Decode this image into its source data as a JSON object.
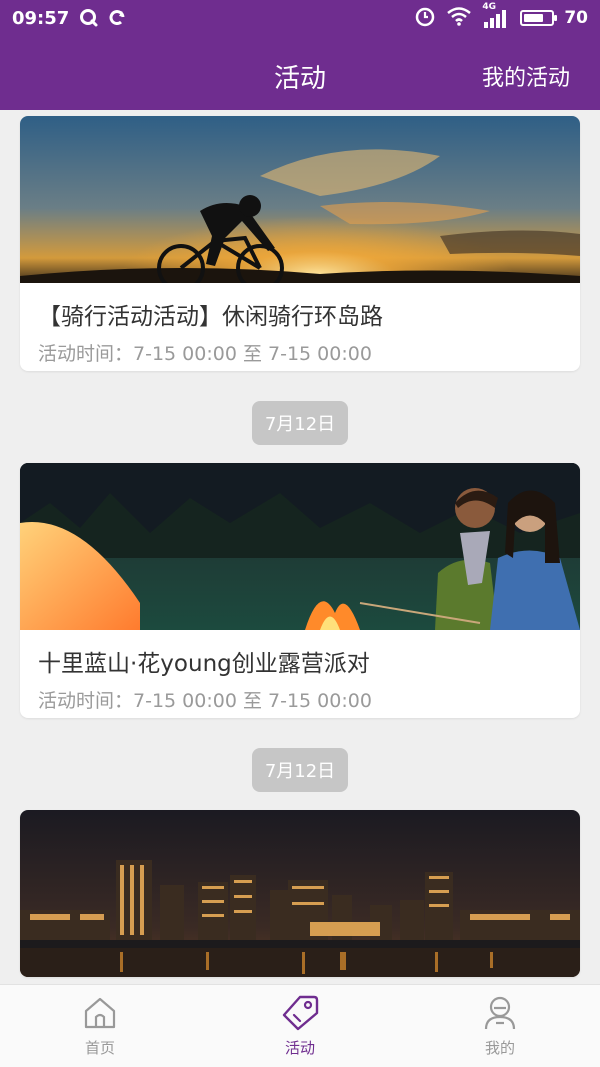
{
  "status_bar": {
    "time": "09:57",
    "battery": "70",
    "battery_level": 0.7,
    "network": "4G"
  },
  "header": {
    "title": "活动",
    "action": "我的活动"
  },
  "cards": [
    {
      "title": "【骑行活动活动】休闲骑行环岛路",
      "time": "活动时间：7-15 00:00 至 7-15 00:00"
    },
    {
      "title": "十里蓝山·花young创业露营派对",
      "time": "活动时间：7-15 00:00 至 7-15 00:00"
    }
  ],
  "date_chips": [
    "7月12日",
    "7月12日"
  ],
  "bottom_nav": [
    {
      "label": "首页",
      "icon": "home-icon"
    },
    {
      "label": "活动",
      "icon": "tag-icon",
      "active": true
    },
    {
      "label": "我的",
      "icon": "user-icon"
    }
  ],
  "colors": {
    "brand": "#6f2d8f",
    "chip": "#c6c6c6",
    "background": "#efefef"
  }
}
